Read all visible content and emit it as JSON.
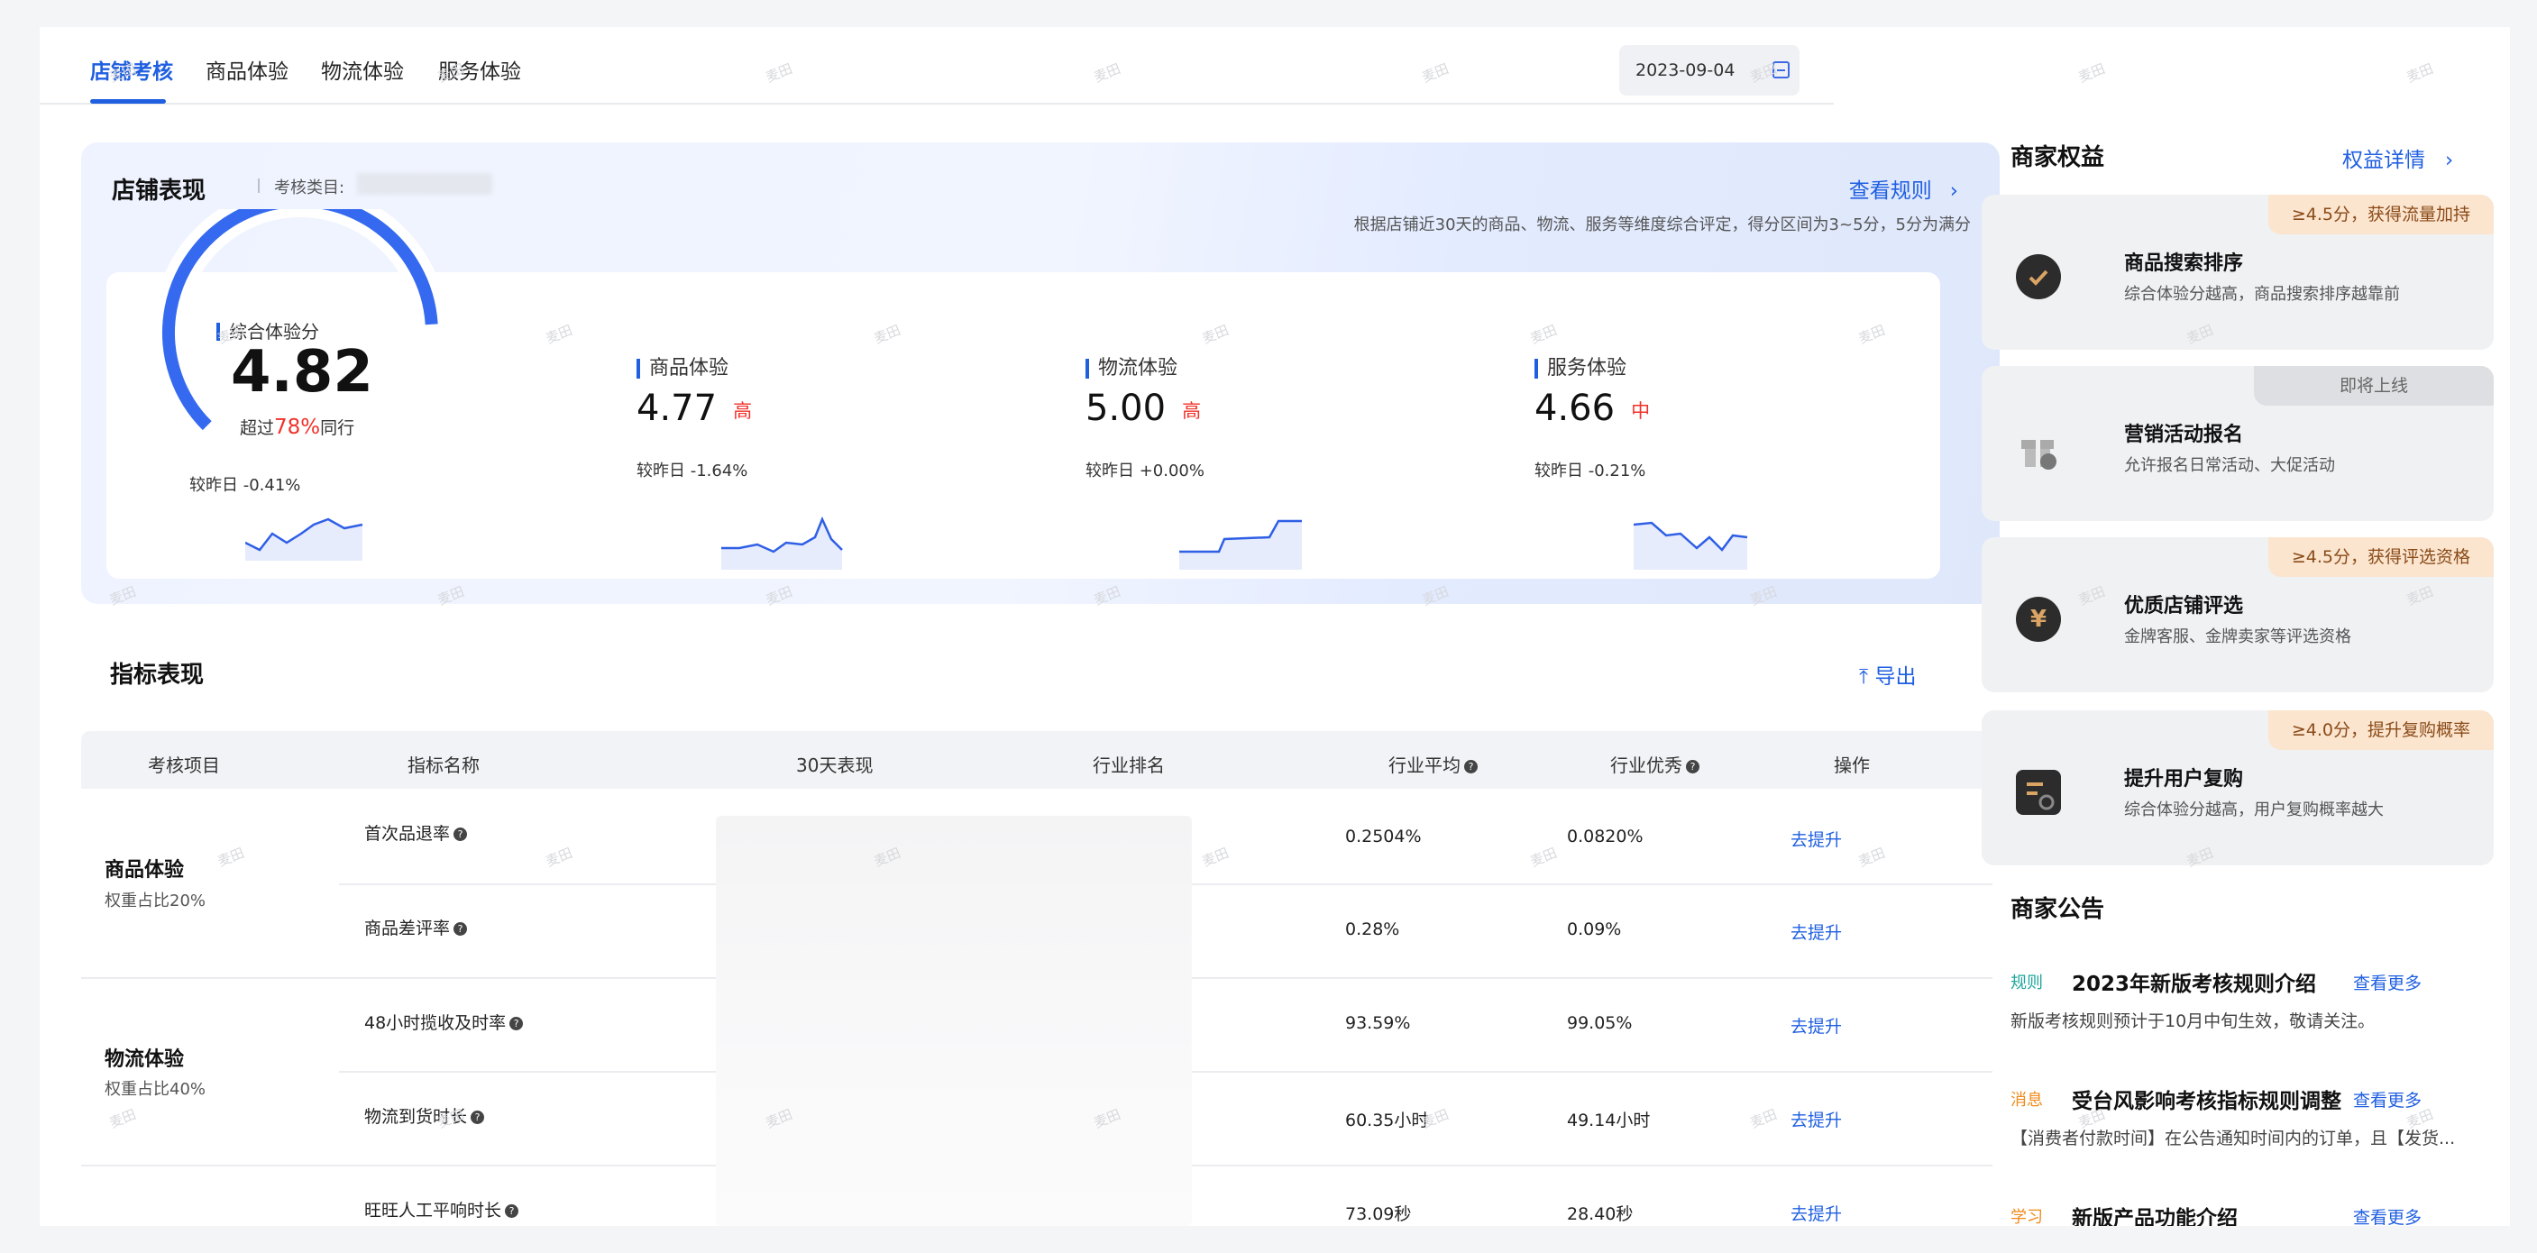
{
  "tabs": [
    "店铺考核",
    "商品体验",
    "物流体验",
    "服务体验"
  ],
  "date": "2023-09-04",
  "performance": {
    "title": "店铺表现",
    "category_label": "考核类目:",
    "rules_link": "查看规则",
    "description": "根据店铺近30天的商品、物流、服务等维度综合评定，得分区间为3~5分，5分为满分",
    "overall": {
      "label": "综合体验分",
      "score": "4.82",
      "rank_prefix": "超过",
      "rank_pct": "78%",
      "rank_suffix": "同行",
      "delta": "较昨日 -0.41%",
      "gauge_fraction": 0.82
    },
    "metrics": [
      {
        "label": "商品体验",
        "score": "4.77",
        "level": "高",
        "delta": "较昨日 -1.64%"
      },
      {
        "label": "物流体验",
        "score": "5.00",
        "level": "高",
        "delta": "较昨日 +0.00%"
      },
      {
        "label": "服务体验",
        "score": "4.66",
        "level": "中",
        "delta": "较昨日 -0.21%"
      }
    ]
  },
  "indicators": {
    "title": "指标表现",
    "export": "导出",
    "headers": [
      "考核项目",
      "指标名称",
      "30天表现",
      "行业排名",
      "行业平均",
      "行业优秀",
      "操作"
    ],
    "categories": [
      {
        "name": "商品体验",
        "weight": "权重占比20%"
      },
      {
        "name": "物流体验",
        "weight": "权重占比40%"
      }
    ],
    "rows": [
      {
        "name": "首次品退率",
        "avg": "0.2504%",
        "excellent": "0.0820%",
        "action": "去提升"
      },
      {
        "name": "商品差评率",
        "avg": "0.28%",
        "excellent": "0.09%",
        "action": "去提升"
      },
      {
        "name": "48小时揽收及时率",
        "avg": "93.59%",
        "excellent": "99.05%",
        "action": "去提升"
      },
      {
        "name": "物流到货时长",
        "avg": "60.35小时",
        "excellent": "49.14小时",
        "action": "去提升"
      },
      {
        "name": "旺旺人工平响时长",
        "avg": "73.09秒",
        "excellent": "28.40秒",
        "action": "去提升"
      }
    ]
  },
  "benefits": {
    "title": "商家权益",
    "link": "权益详情",
    "items": [
      {
        "tag": "≥4.5分，获得流量加持",
        "name": "商品搜索排序",
        "desc": "综合体验分越高，商品搜索排序越靠前",
        "icon": "badge-check-icon"
      },
      {
        "tag": "即将上线",
        "name": "营销活动报名",
        "desc": "允许报名日常活动、大促活动",
        "icon": "gift-icon"
      },
      {
        "tag": "≥4.5分，获得评选资格",
        "name": "优质店铺评选",
        "desc": "金牌客服、金牌卖家等评选资格",
        "icon": "yen-icon"
      },
      {
        "tag": "≥4.0分，提升复购概率",
        "name": "提升用户复购",
        "desc": "综合体验分越高，用户复购概率越大",
        "icon": "repurchase-icon"
      }
    ]
  },
  "announcements": {
    "title": "商家公告",
    "items": [
      {
        "tag": "规则",
        "title": "2023年新版考核规则介绍",
        "more": "查看更多",
        "desc": "新版考核规则预计于10月中旬生效，敬请关注。"
      },
      {
        "tag": "消息",
        "title": "受台风影响考核指标规则调整",
        "more": "查看更多",
        "desc": "【消费者付款时间】在公告通知时间内的订单，且【发货..."
      },
      {
        "tag": "学习",
        "title": "新版产品功能介绍",
        "more": "查看更多",
        "desc": ""
      }
    ]
  },
  "watermark": "麦田",
  "colors": {
    "accent": "#1f5fe0",
    "danger": "#f0322a",
    "warm_tag": "#fbe5cf"
  }
}
